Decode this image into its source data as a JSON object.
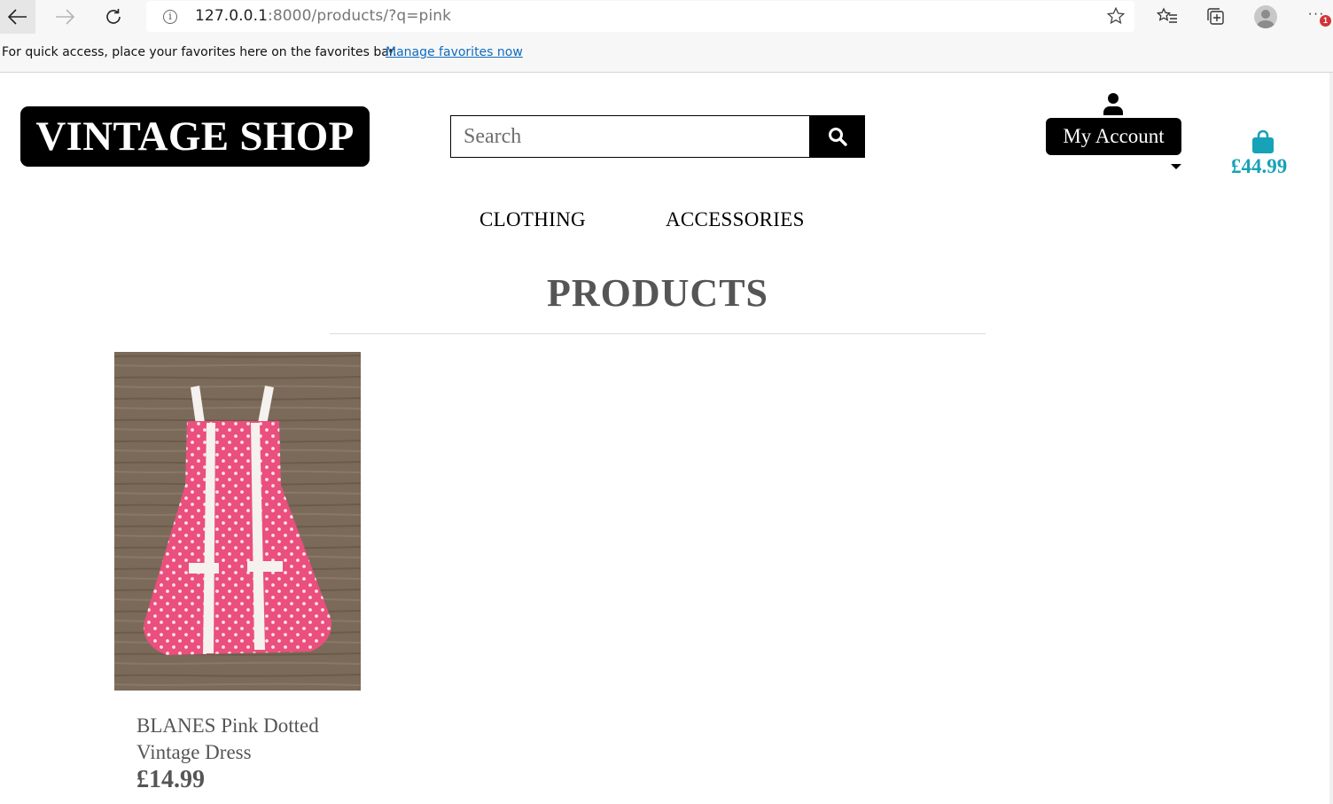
{
  "browser": {
    "url_host": "127.0.0.1",
    "url_rest": ":8000/products/?q=pink",
    "notification_badge": "1",
    "icons": [
      "back-arrow-icon",
      "forward-arrow-icon",
      "reload-icon",
      "info-icon",
      "star-icon",
      "favorites-icon",
      "collections-icon",
      "profile-avatar",
      "more-icon"
    ]
  },
  "favorites_bar": {
    "message": "For quick access, place your favorites here on the favorites bar.",
    "link": "Manage favorites now"
  },
  "header": {
    "logo": "VINTAGE SHOP",
    "search_placeholder": "Search",
    "account_label": "My Account",
    "bag_total": "£44.99",
    "bag_color": "#17a2b8"
  },
  "nav": {
    "items": [
      {
        "label": "CLOTHING"
      },
      {
        "label": "ACCESSORIES"
      }
    ]
  },
  "main": {
    "title": "PRODUCTS",
    "products": [
      {
        "name": "BLANES Pink Dotted Vintage Dress",
        "price": "£14.99"
      }
    ]
  }
}
